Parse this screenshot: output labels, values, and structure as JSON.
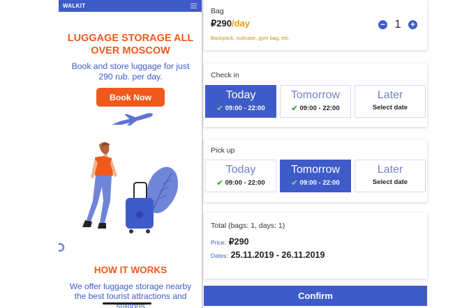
{
  "left": {
    "brand": "WALKIT",
    "hero_title": "LUGGAGE STORAGE ALL OVER MOSCOW",
    "hero_subtitle": "Book and store luggage for just 290 rub. per day.",
    "book_button": "Book Now",
    "how_title": "HOW IT WORKS",
    "how_text": "We offer luggage storage nearby the best tourist attractions and stations"
  },
  "bag": {
    "label": "Bag",
    "price": "₽290",
    "per": "/day",
    "description": "Backpack, suitcase, gym bag, etc.",
    "quantity": "1",
    "minus_symbol": "−",
    "plus_symbol": "+"
  },
  "checkin": {
    "label": "Check in",
    "options": [
      {
        "name": "Today",
        "sub": "09:00 - 22:00",
        "checked": true,
        "active": true
      },
      {
        "name": "Tomorrow",
        "sub": "09:00 - 22:00",
        "checked": true,
        "active": false
      },
      {
        "name": "Later",
        "sub": "Select date",
        "checked": false,
        "active": false
      }
    ]
  },
  "pickup": {
    "label": "Pick up",
    "options": [
      {
        "name": "Today",
        "sub": "09:00 - 22:00",
        "checked": true,
        "active": false
      },
      {
        "name": "Tomorrow",
        "sub": "09:00 - 22:00",
        "checked": true,
        "active": true
      },
      {
        "name": "Later",
        "sub": "Select date",
        "checked": false,
        "active": false
      }
    ]
  },
  "total": {
    "heading": "Total (bags: 1, days: 1)",
    "price_label": "Price:",
    "price_value": "₽290",
    "dates_label": "Dates:",
    "dates_value": "25.11.2019 - 26.11.2019"
  },
  "confirm_label": "Confirm",
  "icons": {
    "check": "checkmark-icon",
    "menu": "hamburger-menu-icon",
    "plane": "airplane-icon"
  },
  "colors": {
    "primary": "#3f5bc9",
    "accent": "#ef5a1c",
    "price_per": "#f09a1c",
    "check": "#3aaa47"
  }
}
